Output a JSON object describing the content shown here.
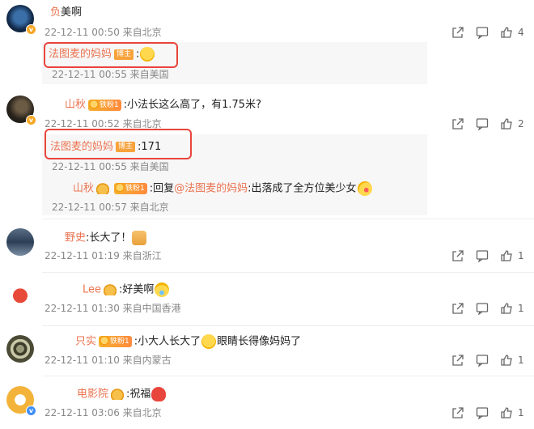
{
  "colors": {
    "accent": "#eb7350",
    "highlight": "#e8453c",
    "badge": "#f7a23b",
    "meta": "#888888"
  },
  "comments": [
    {
      "author": "",
      "author_suffix": "负",
      "text": "美啊",
      "meta": "22-12-11 00:50 来自北京",
      "likes": "4",
      "replies": [
        {
          "author": "法图麦的妈妈",
          "badge": "博主",
          "text": ":",
          "emoji": "grin-sweat-emoji",
          "meta": "22-12-11 00:55 来自美国"
        }
      ]
    },
    {
      "author": "山秋",
      "fan_badge": "铁粉1",
      "text": ":小法长这么高了，有1.75米?",
      "meta": "22-12-11 00:52 来自北京",
      "likes": "2",
      "replies": [
        {
          "author": "法图麦的妈妈",
          "badge": "博主",
          "text": ":171",
          "meta": "22-12-11 00:55 来自美国"
        },
        {
          "author": "山秋",
          "fan_badge": "铁粉1",
          "text_prefix": ":回复",
          "mention": "@法图麦的妈妈",
          "text": ":出落成了全方位美少女",
          "emoji": "kiss-emoji",
          "meta": "22-12-11 00:57 来自北京"
        }
      ]
    },
    {
      "author": "野史",
      "text": ":长大了！",
      "emoji": "thumbs-up-emoji",
      "meta": "22-12-11 01:19 来自浙江",
      "likes": "1"
    },
    {
      "author": "Lee",
      "text": ":好美啊",
      "emoji": "crying-emoji",
      "meta": "22-12-11 01:30 来自中国香港",
      "likes": "1"
    },
    {
      "author": "只实",
      "fan_badge": "铁粉1",
      "text": ":小大人长大了",
      "text_after": "眼睛长得像妈妈了",
      "emoji": "smile-emoji",
      "meta": "22-12-11 01:10 来自内蒙古",
      "likes": "1"
    },
    {
      "author": "电影院",
      "text": ":祝福",
      "emoji": "heart-emoji",
      "meta": "22-12-11 03:06 来自北京",
      "likes": "1"
    }
  ]
}
